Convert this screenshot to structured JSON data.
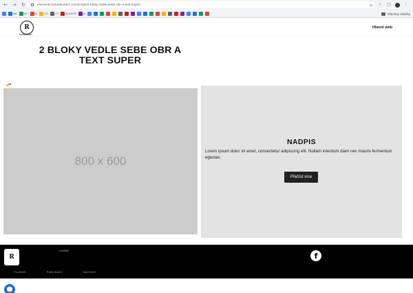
{
  "browser": {
    "url": "elements.tomaskunert.com/scripti/2-bloky-vedle-sebe-obr-a-text-super/",
    "zoom_label": "Q+",
    "bookmarks": [
      "",
      "MB",
      "MC",
      "AI",
      "GD",
      "YT",
      "ADASOR",
      "AI",
      "",
      "",
      "",
      "",
      "",
      "",
      "",
      "",
      "",
      "",
      "",
      "",
      "",
      "",
      "",
      "",
      "",
      "",
      "",
      ""
    ],
    "all_bookmarks_label": "Všechny záložky"
  },
  "header": {
    "logo_caption": "TomasKunert",
    "nav_main_link": "Hlavní web"
  },
  "page": {
    "heading": "2 BLOKY VEDLE SEBE OBR A TEXT SUPER"
  },
  "image_block": {
    "placeholder_label": "800 x 600"
  },
  "text_block": {
    "title": "NADPIS",
    "body": "Lorem ipsum dolor sit amet, consectetur adipiscing elit. Nullam interdum diam nec mauris fermentum egestas.",
    "button_label": "Přečíst více"
  },
  "footer": {
    "contact_text": "• LEONIS",
    "links": [
      "PLUGINS",
      "PUBLIKACE",
      "NÁVODKY"
    ]
  },
  "colors": {
    "text_block_bg": "#e3e3e3",
    "image_placeholder_bg": "#cccccc",
    "button_bg": "#222222",
    "footer_bg": "#000000",
    "chat_widget": "#1d6fd6"
  }
}
